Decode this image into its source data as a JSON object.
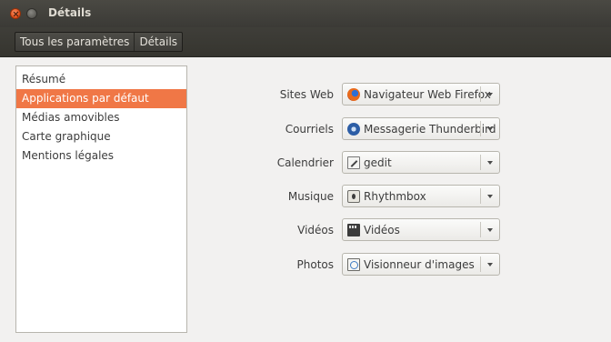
{
  "window": {
    "title": "Détails"
  },
  "breadcrumb": [
    "Tous les paramètres",
    "Détails"
  ],
  "sidebar": {
    "items": [
      {
        "label": "Résumé"
      },
      {
        "label": "Applications par défaut"
      },
      {
        "label": "Médias amovibles"
      },
      {
        "label": "Carte graphique"
      },
      {
        "label": "Mentions légales"
      }
    ],
    "selected": "Applications par défaut",
    "selected_color": "#f07746"
  },
  "defaults": {
    "web": {
      "label": "Sites Web",
      "value": "Navigateur Web Firefox",
      "icon": "firefox-icon"
    },
    "mail": {
      "label": "Courriels",
      "value": "Messagerie Thunderbird",
      "icon": "thunderbird-icon"
    },
    "calendar": {
      "label": "Calendrier",
      "value": "gedit",
      "icon": "gedit-icon"
    },
    "music": {
      "label": "Musique",
      "value": "Rhythmbox",
      "icon": "rhythmbox-icon"
    },
    "video": {
      "label": "Vidéos",
      "value": "Vidéos",
      "icon": "videos-icon"
    },
    "photos": {
      "label": "Photos",
      "value": "Visionneur d'images",
      "icon": "image-viewer-icon"
    }
  }
}
